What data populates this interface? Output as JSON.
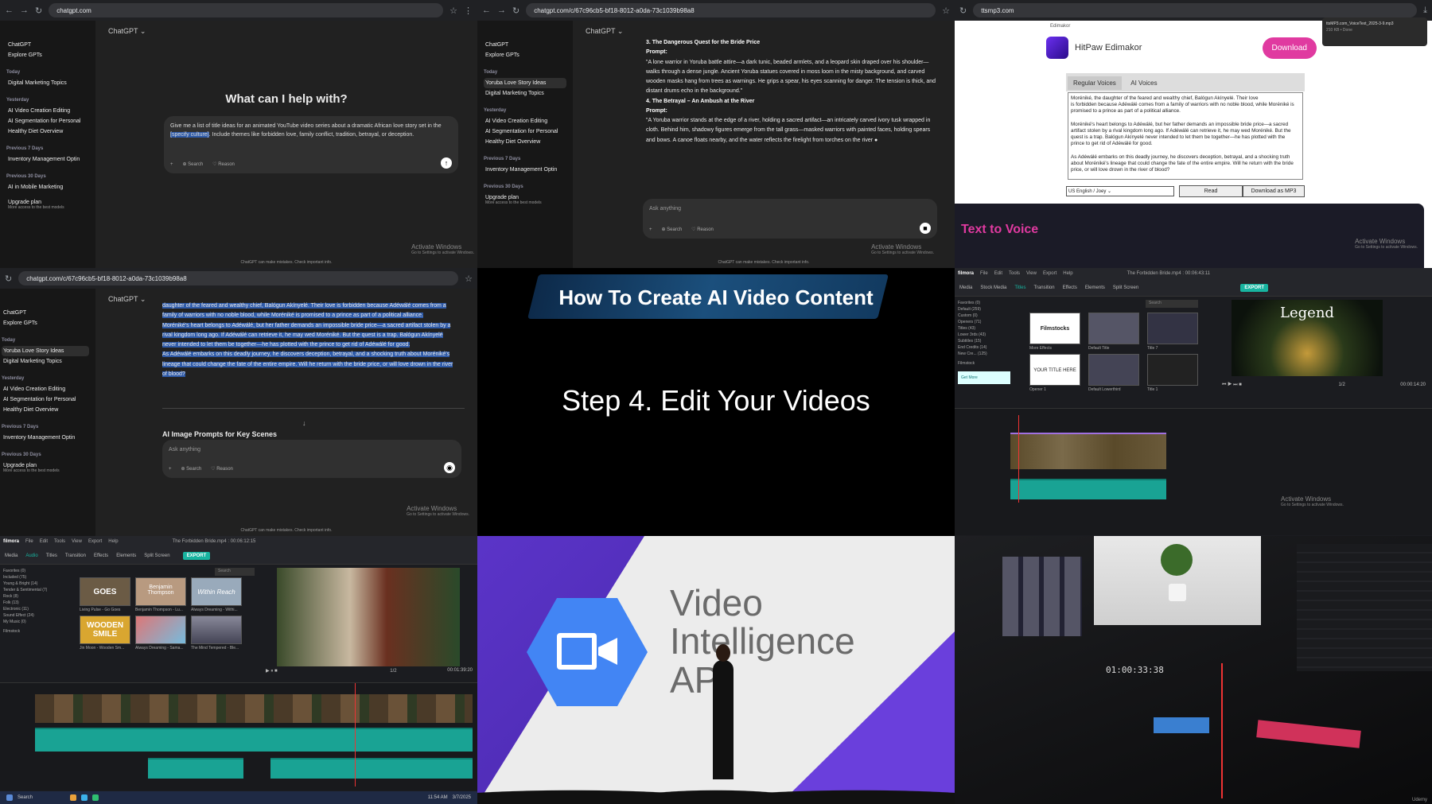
{
  "panel1": {
    "url": "chatgpt.com",
    "side": [
      "ChatGPT",
      "Explore GPTs"
    ],
    "sections": [
      {
        "title": "Today",
        "items": [
          "Digital Marketing Topics"
        ]
      },
      {
        "title": "Yesterday",
        "items": [
          "AI Video Creation Editing",
          "AI Segmentation for Personal",
          "Healthy Diet Overview"
        ]
      },
      {
        "title": "Previous 7 Days",
        "items": [
          "Inventory Management Optin"
        ]
      },
      {
        "title": "Previous 30 Days",
        "items": [
          "AI in Mobile Marketing"
        ]
      }
    ],
    "upgrade": "Upgrade plan",
    "upgrade_sub": "More access to the best models",
    "model": "ChatGPT",
    "heading": "What can I help with?",
    "prompt_a": "Give me a list of title ideas for an animated YouTube video series about a dramatic African love story set in the ",
    "prompt_hl": "[specify culture]",
    "prompt_b": ". Include themes like forbidden love, family conflict, tradition, betrayal, or deception.",
    "search": "Search",
    "reason": "Reason",
    "footer": "ChatGPT can make mistakes. Check important info.",
    "watermark": "Activate Windows",
    "watermark_sub": "Go to Settings to activate Windows."
  },
  "panel2": {
    "url": "chatgpt.com/c/67c96cb5-bf18-8012-a0da-73c1039b98a8",
    "side": [
      "ChatGPT",
      "Explore GPTs"
    ],
    "sections": [
      {
        "title": "",
        "items": [
          "Yoruba Love Story Ideas",
          "Digital Marketing Topics"
        ]
      },
      {
        "title": "Yesterday",
        "items": [
          "AI Video Creation Editing",
          "AI Segmentation for Personal",
          "Healthy Diet Overview"
        ]
      },
      {
        "title": "Previous 7 Days",
        "items": [
          "Inventory Management Optin"
        ]
      },
      {
        "title": "Previous 30 Days",
        "items": []
      }
    ],
    "upgrade": "Upgrade plan",
    "upgrade_sub": "More access to the best models",
    "model": "ChatGPT",
    "h3": "3. The Dangerous Quest for the Bride Price",
    "prompt_label": "Prompt:",
    "p3": "\"A lone warrior in Yoruba battle attire—a dark tunic, beaded armlets, and a leopard skin draped over his shoulder—walks through a dense jungle. Ancient Yoruba statues covered in moss loom in the misty background, and carved wooden masks hang from trees as warnings. He grips a spear, his eyes scanning for danger. The tension is thick, and distant drums echo in the background.\"",
    "h4": "4. The Betrayal – An Ambush at the River",
    "p4": "\"A Yoruba warrior stands at the edge of a river, holding a sacred artifact—an intricately carved ivory tusk wrapped in cloth. Behind him, shadowy figures emerge from the tall grass—masked warriors with painted faces, holding spears and bows. A canoe floats nearby, and the water reflects the firelight from torches on the river",
    "ask": "Ask anything",
    "search": "Search",
    "reason": "Reason",
    "footer": "ChatGPT can make mistakes. Check important info.",
    "watermark": "Activate Windows",
    "watermark_sub": "Go to Settings to activate Windows."
  },
  "panel3": {
    "url": "ttsmp3.com",
    "brand": "HitPaw Edimakor",
    "small_brand": "Edimakor",
    "download": "Download",
    "dl_file": "ttsMP3.com_VoiceText_2025-3-9.mp3",
    "dl_status": "210 KB • Done",
    "tab1": "Regular Voices",
    "tab2": "AI Voices",
    "para1": "is forbidden because Adéwálé comes from a family of warriors with no noble blood, while Moréniké is promised to a prince as part of a political alliance.",
    "para1_pre": "Moréniké, the daughter of the feared and wealthy chief, Balógun Akínyelé. Their love",
    "para2": "Moréniké's heart belongs to Adéwálé, but her father demands an impossible bride price—a sacred artifact stolen by a rival kingdom long ago. If Adéwálé can retrieve it, he may wed Moréniké. But the quest is a trap. Balógun Akínyelé never intended to let them be together—he has plotted with the prince to get rid of Adéwálé for good.",
    "para3": "As Adéwálé embarks on this deadly journey, he discovers deception, betrayal, and a shocking truth about Moréniké's lineage that could change the fate of the entire empire. Will he return with the bride price, or will love drown in the river of blood?",
    "voice": "US English / Joey",
    "read": "Read",
    "mp3": "Download as MP3",
    "ttv": "Text to Voice",
    "watermark": "Activate Windows",
    "watermark_sub": "Go to Settings to activate Windows."
  },
  "panel4": {
    "url": "chatgpt.com/c/67c96cb5-bf18-8012-a0da-73c1039b98a8",
    "side": [
      "ChatGPT",
      "Explore GPTs"
    ],
    "sections": [
      {
        "title": "",
        "items": [
          "Yoruba Love Story Ideas",
          "Digital Marketing Topics"
        ]
      },
      {
        "title": "Yesterday",
        "items": [
          "AI Video Creation Editing",
          "AI Segmentation for Personal",
          "Healthy Diet Overview"
        ]
      },
      {
        "title": "Previous 7 Days",
        "items": [
          "Inventory Management Optin"
        ]
      },
      {
        "title": "Previous 30 Days",
        "items": []
      }
    ],
    "upgrade": "Upgrade plan",
    "upgrade_sub": "More access to the best models",
    "model": "ChatGPT",
    "l1": "daughter of the feared and wealthy chief, Balógun Akínyelé. Their love is forbidden because Adéwálé comes from a family of warriors with no noble blood, while Moréniké is promised to a prince as part of a political alliance.",
    "l2": "Moréniké's heart belongs to Adéwálé, but her father demands an impossible bride price—a sacred artifact stolen by a rival kingdom long ago. If Adéwálé can retrieve it, he may wed Moréniké. But the quest is a trap. Balógun Akínyelé never intended to let them be together—he has plotted with the prince to get rid of Adéwálé for good.",
    "l3": "As Adéwálé embarks on this deadly journey, he discovers deception, betrayal, and a shocking truth about Moréniké's lineage that could change the fate of the entire empire. Will he return with the bride price, or will love drown in the river of blood?",
    "h": "AI Image Prompts for Key Scenes",
    "ask": "Ask anything",
    "search": "Search",
    "reason": "Reason",
    "footer": "ChatGPT can make mistakes. Check important info.",
    "watermark": "Activate Windows",
    "watermark_sub": "Go to Settings to activate Windows."
  },
  "panel5": {
    "title": "How To Create AI Video Content",
    "step": "Step 4. Edit Your Videos"
  },
  "panel6": {
    "app": "filmora",
    "menu": [
      "File",
      "Edit",
      "Tools",
      "View",
      "Export",
      "Help"
    ],
    "project": "The Forbidden Bride.mp4 : 00:06:43:11",
    "tools": [
      "Media",
      "Stock Media",
      "Titles",
      "Transition",
      "Effects",
      "Elements",
      "Split Screen"
    ],
    "export": "EXPORT",
    "fav": "Favorites (0)",
    "cats": [
      "Default (259)",
      "Custom (0)",
      "Openers (71)",
      "Titles (43)",
      "Lower 3rds (43)",
      "Subtitles (15)",
      "End Credits (14)",
      "New Cre... (125)"
    ],
    "filmstock": "Filmstock",
    "thumbs": [
      "Filmstocks",
      "Default Title",
      "Title 7",
      "YOUR TITLE HERE",
      "Default Lowerthird",
      "Title 1"
    ],
    "more": "More Effects",
    "get_more": "Get More",
    "opener": "Opener 1",
    "preview_title": "Legend",
    "time": "00:00:14:20",
    "ratio": "1/2",
    "search": "Search",
    "watermark": "Activate Windows",
    "watermark_sub": "Go to Settings to activate Windows."
  },
  "panel7": {
    "app": "filmora",
    "menu": [
      "File",
      "Edit",
      "Tools",
      "View",
      "Export",
      "Help"
    ],
    "project": "The Forbidden Bride.mp4 : 00:06:12:15",
    "tools": [
      "Media",
      "Audio",
      "Titles",
      "Transition",
      "Effects",
      "Elements",
      "Split Screen"
    ],
    "export": "EXPORT",
    "fav": "Favorites (0)",
    "cats": [
      "Included (75)",
      "Young & Bright (14)",
      "Tender & Sentimental (7)",
      "Rock (8)",
      "Folk (13)",
      "Electronic (11)",
      "Sound Effect (24)",
      "My Music (0)"
    ],
    "filmstock": "Filmstock",
    "thumbs": [
      "Living Pulse - Go Goes",
      "Benjamin Thompson - Lu...",
      "Always Dreaming - Withi...",
      "Jin Moon - Wooden Sm...",
      "Always Dreaming - Sama...",
      "The Mind Tempered - Ble..."
    ],
    "thumb_titles": [
      "GOES",
      "Benjamin Thompson",
      "Within Reach",
      "WOODEN SMILE"
    ],
    "time": "00:01:39:20",
    "ratio": "1/2",
    "search": "Search",
    "taskbar_search": "Search",
    "clock": "11:54 AM",
    "date": "3/7/2025",
    "watermark": "Activate Windows",
    "watermark_sub": "Go to Settings to activate Windows."
  },
  "panel8": {
    "text1": "Video",
    "text2": "Intelligence",
    "text3": "API"
  },
  "panel9": {
    "timecode": "01:00:33:38",
    "brand": "Udemy"
  },
  "colors": {
    "accent": "#18b4a0",
    "tts_pink": "#e03aa0",
    "google_blue": "#4285f4"
  }
}
